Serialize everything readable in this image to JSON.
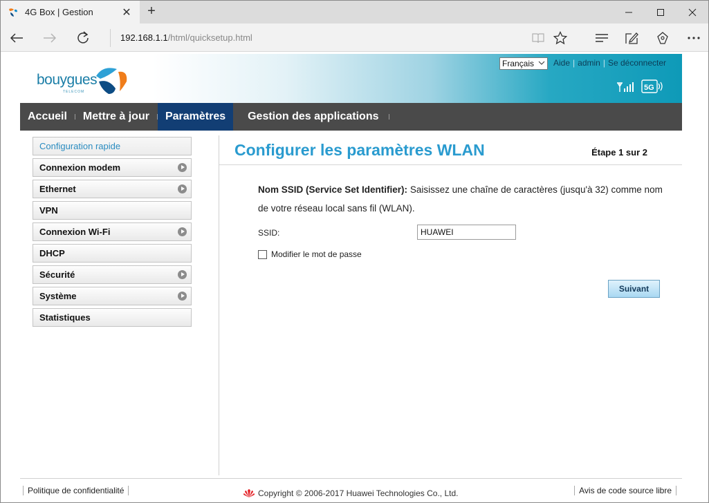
{
  "browser": {
    "tab_title": "4G Box | Gestion",
    "address_host": "192.168.1.1",
    "address_path": "/html/quicksetup.html"
  },
  "header": {
    "logo_text": "bouygues",
    "logo_subtext": "TELECOM",
    "language": "Français",
    "help_link": "Aide",
    "user_link": "admin",
    "logout_link": "Se déconnecter",
    "network_badge": "5G"
  },
  "menu": {
    "items": [
      {
        "label": "Accueil"
      },
      {
        "label": "Mettre à jour"
      },
      {
        "label": "Paramètres"
      },
      {
        "label": "Gestion des applications"
      }
    ]
  },
  "sidebar": {
    "items": [
      {
        "label": "Configuration rapide"
      },
      {
        "label": "Connexion modem"
      },
      {
        "label": "Ethernet"
      },
      {
        "label": "VPN"
      },
      {
        "label": "Connexion Wi-Fi"
      },
      {
        "label": "DHCP"
      },
      {
        "label": "Sécurité"
      },
      {
        "label": "Système"
      },
      {
        "label": "Statistiques"
      }
    ]
  },
  "main": {
    "title": "Configurer les paramètres WLAN",
    "step": "Étape 1 sur 2",
    "desc_bold": "Nom SSID (Service Set Identifier):",
    "desc_text": " Saisissez une chaîne de caractères (jusqu'à 32) comme nom de votre réseau local sans fil (WLAN).",
    "ssid_label": "SSID:",
    "ssid_value": "HUAWEI",
    "change_password_label": "Modifier le mot de passe",
    "change_password_checked": false,
    "next_button": "Suivant"
  },
  "footer": {
    "privacy": "Politique de confidentialité",
    "copyright": "Copyright © 2006-2017 Huawei Technologies Co., Ltd.",
    "source_notice": "Avis de code source libre"
  },
  "colors": {
    "accent": "#2a9bcf",
    "menu_bg": "#4a4a4a",
    "menu_active": "#123e74",
    "header_gradient_end": "#0e9ab8"
  }
}
